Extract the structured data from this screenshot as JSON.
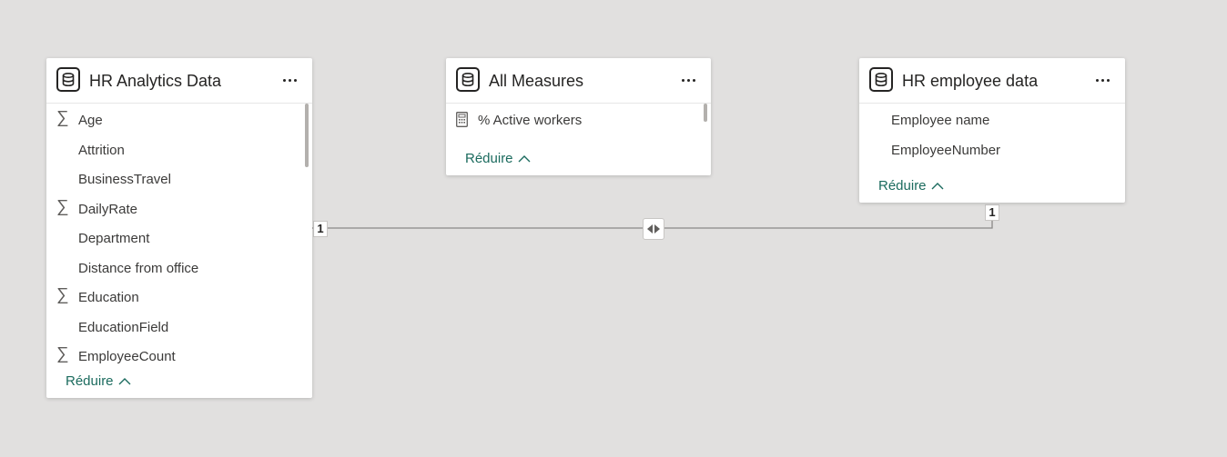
{
  "tables": [
    {
      "title": "HR Analytics Data",
      "fields": [
        {
          "name": "Age",
          "icon": "sigma-icon"
        },
        {
          "name": "Attrition",
          "icon": ""
        },
        {
          "name": "BusinessTravel",
          "icon": ""
        },
        {
          "name": "DailyRate",
          "icon": "sigma-icon"
        },
        {
          "name": "Department",
          "icon": ""
        },
        {
          "name": "Distance from office",
          "icon": ""
        },
        {
          "name": "Education",
          "icon": "sigma-icon"
        },
        {
          "name": "EducationField",
          "icon": ""
        },
        {
          "name": "EmployeeCount",
          "icon": "sigma-icon"
        }
      ],
      "collapse_label": "Réduire"
    },
    {
      "title": "All Measures",
      "fields": [
        {
          "name": "% Active workers",
          "icon": "calculator-icon"
        }
      ],
      "collapse_label": "Réduire"
    },
    {
      "title": "HR employee data",
      "fields": [
        {
          "name": "Employee name",
          "icon": ""
        },
        {
          "name": "EmployeeNumber",
          "icon": ""
        }
      ],
      "collapse_label": "Réduire"
    }
  ],
  "relationship": {
    "from_cardinality": "1",
    "to_cardinality": "1",
    "filter_direction": "both",
    "direction_icon": "bidirectional-arrow-icon"
  },
  "colors": {
    "canvas": "#e1e0df",
    "link": "#1b6b5e",
    "line": "#8a8886"
  }
}
